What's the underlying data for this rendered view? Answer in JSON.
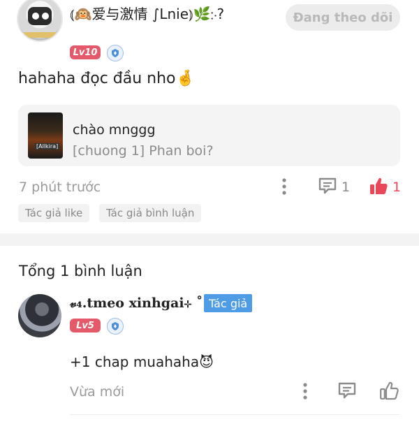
{
  "post": {
    "author_name": "⦅🙉爱与激情 ∫Lnie⦆🌿჻?",
    "follow_label": "Đang theo dõi",
    "level": "Lv10",
    "text": "hahaha đọc đầu nho🤞",
    "linked": {
      "title": "chào mnggg",
      "subtitle": "[chuong 1] Phan boi?",
      "thumb_tag": "[Allkira]"
    },
    "time": "7 phút trước",
    "comment_count": "1",
    "like_count": "1",
    "chips": [
      "Tác giả like",
      "Tác giả bình luận"
    ]
  },
  "comments_section": {
    "total_label": "Tổng 1 bình luận"
  },
  "comment": {
    "author_name": "𝓋₄.tmeo xinhgai⊹ ˚",
    "author_tag": "Tác giả",
    "level": "Lv5",
    "text": "+1 chap muahaha😈",
    "time": "Vừa mới"
  },
  "colors": {
    "accent_red": "#e8485a",
    "level_badge": "#e55a6a",
    "author_tag": "#4e9be6"
  }
}
